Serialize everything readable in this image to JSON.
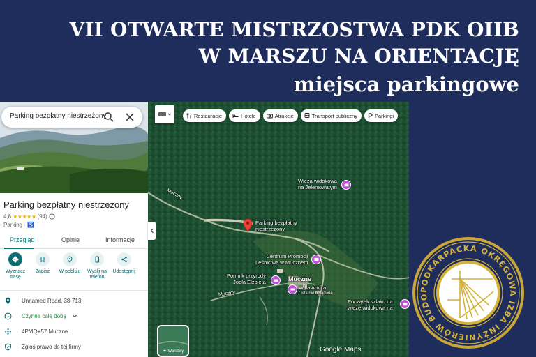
{
  "title": {
    "line1": "VII OTWARTE MISTRZOSTWA PDK OIIB",
    "line2": "W MARSZU NA ORIENTACJĘ",
    "line3": "miejsca parkingowe"
  },
  "panel": {
    "search_value": "Parking bezpłatny niestrzeżony",
    "place_name": "Parking bezpłatny niestrzeżony",
    "rating": "4,8",
    "stars": "★★★★★",
    "reviews": "(94)",
    "category": "Parking · ♿",
    "tabs": [
      "Przegląd",
      "Opinie",
      "Informacje"
    ],
    "actions": [
      {
        "label": "Wyznacz\ntrasę",
        "icon": "directions-icon"
      },
      {
        "label": "Zapisz",
        "icon": "bookmark-icon"
      },
      {
        "label": "W pobliżu",
        "icon": "nearby-icon"
      },
      {
        "label": "Wyślij na\ntelefon",
        "icon": "phone-icon"
      },
      {
        "label": "Udostępnij",
        "icon": "share-icon"
      }
    ],
    "info": {
      "address": "Unnamed Road, 38-713",
      "hours": "Czynne całą dobę",
      "plus_code": "4PMQ+57 Muczne",
      "claim": "Zgłoś prawo do tej firmy"
    }
  },
  "map": {
    "chips": [
      {
        "label": "Restauracje",
        "icon": "restaurant-icon"
      },
      {
        "label": "Hotele",
        "icon": "hotel-icon"
      },
      {
        "label": "Atrakcje",
        "icon": "camera-icon"
      },
      {
        "label": "Transport publiczny",
        "icon": "transit-icon"
      },
      {
        "label": "Parkingi",
        "icon": "parking-icon"
      }
    ],
    "layers_label": "Warstwy",
    "logo": "Google Maps",
    "labels": {
      "wieza_1": "Wieża widokowa",
      "wieza_2": "na Jeleniowatym",
      "parking_1": "Parking bezpłatny",
      "parking_2": "niestrzeżony",
      "centrum_1": "Centrum Promocji",
      "centrum_2": "Leśnictwa w Mucznem",
      "pomnik_1": "Pomnik przyrody",
      "pomnik_2": "Jodła Elżbieta",
      "muczne": "Muczne",
      "willa_1": "Willa Arnika",
      "willa_2": "Ostatnio oglądane",
      "szlak_1": "Początek szlaku na",
      "szlak_2": "wieżę widokową na",
      "road_muczny_1": "Muczny",
      "road_muczny_2": "Muczny"
    }
  },
  "badge": {
    "ring_text": "PODKARPACKA OKRĘGOWA IZBA INŻYNIERÓW BUDOWNICTWA"
  },
  "colors": {
    "background": "#1f2d5c",
    "accent": "#0b6e72",
    "badge_gold": "#d4b23c"
  }
}
